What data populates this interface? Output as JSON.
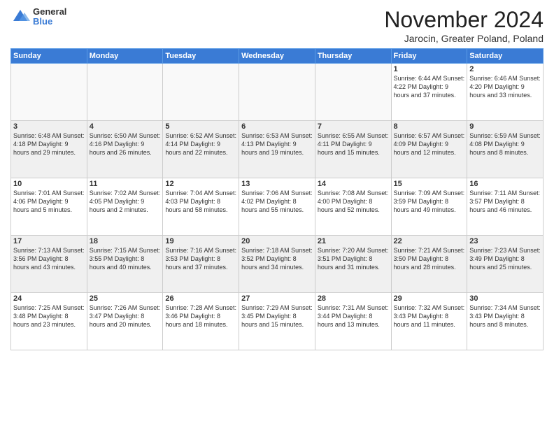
{
  "logo": {
    "general": "General",
    "blue": "Blue"
  },
  "header": {
    "title": "November 2024",
    "location": "Jarocin, Greater Poland, Poland"
  },
  "weekdays": [
    "Sunday",
    "Monday",
    "Tuesday",
    "Wednesday",
    "Thursday",
    "Friday",
    "Saturday"
  ],
  "weeks": [
    [
      {
        "day": "",
        "info": ""
      },
      {
        "day": "",
        "info": ""
      },
      {
        "day": "",
        "info": ""
      },
      {
        "day": "",
        "info": ""
      },
      {
        "day": "",
        "info": ""
      },
      {
        "day": "1",
        "info": "Sunrise: 6:44 AM\nSunset: 4:22 PM\nDaylight: 9 hours and 37 minutes."
      },
      {
        "day": "2",
        "info": "Sunrise: 6:46 AM\nSunset: 4:20 PM\nDaylight: 9 hours and 33 minutes."
      }
    ],
    [
      {
        "day": "3",
        "info": "Sunrise: 6:48 AM\nSunset: 4:18 PM\nDaylight: 9 hours and 29 minutes."
      },
      {
        "day": "4",
        "info": "Sunrise: 6:50 AM\nSunset: 4:16 PM\nDaylight: 9 hours and 26 minutes."
      },
      {
        "day": "5",
        "info": "Sunrise: 6:52 AM\nSunset: 4:14 PM\nDaylight: 9 hours and 22 minutes."
      },
      {
        "day": "6",
        "info": "Sunrise: 6:53 AM\nSunset: 4:13 PM\nDaylight: 9 hours and 19 minutes."
      },
      {
        "day": "7",
        "info": "Sunrise: 6:55 AM\nSunset: 4:11 PM\nDaylight: 9 hours and 15 minutes."
      },
      {
        "day": "8",
        "info": "Sunrise: 6:57 AM\nSunset: 4:09 PM\nDaylight: 9 hours and 12 minutes."
      },
      {
        "day": "9",
        "info": "Sunrise: 6:59 AM\nSunset: 4:08 PM\nDaylight: 9 hours and 8 minutes."
      }
    ],
    [
      {
        "day": "10",
        "info": "Sunrise: 7:01 AM\nSunset: 4:06 PM\nDaylight: 9 hours and 5 minutes."
      },
      {
        "day": "11",
        "info": "Sunrise: 7:02 AM\nSunset: 4:05 PM\nDaylight: 9 hours and 2 minutes."
      },
      {
        "day": "12",
        "info": "Sunrise: 7:04 AM\nSunset: 4:03 PM\nDaylight: 8 hours and 58 minutes."
      },
      {
        "day": "13",
        "info": "Sunrise: 7:06 AM\nSunset: 4:02 PM\nDaylight: 8 hours and 55 minutes."
      },
      {
        "day": "14",
        "info": "Sunrise: 7:08 AM\nSunset: 4:00 PM\nDaylight: 8 hours and 52 minutes."
      },
      {
        "day": "15",
        "info": "Sunrise: 7:09 AM\nSunset: 3:59 PM\nDaylight: 8 hours and 49 minutes."
      },
      {
        "day": "16",
        "info": "Sunrise: 7:11 AM\nSunset: 3:57 PM\nDaylight: 8 hours and 46 minutes."
      }
    ],
    [
      {
        "day": "17",
        "info": "Sunrise: 7:13 AM\nSunset: 3:56 PM\nDaylight: 8 hours and 43 minutes."
      },
      {
        "day": "18",
        "info": "Sunrise: 7:15 AM\nSunset: 3:55 PM\nDaylight: 8 hours and 40 minutes."
      },
      {
        "day": "19",
        "info": "Sunrise: 7:16 AM\nSunset: 3:53 PM\nDaylight: 8 hours and 37 minutes."
      },
      {
        "day": "20",
        "info": "Sunrise: 7:18 AM\nSunset: 3:52 PM\nDaylight: 8 hours and 34 minutes."
      },
      {
        "day": "21",
        "info": "Sunrise: 7:20 AM\nSunset: 3:51 PM\nDaylight: 8 hours and 31 minutes."
      },
      {
        "day": "22",
        "info": "Sunrise: 7:21 AM\nSunset: 3:50 PM\nDaylight: 8 hours and 28 minutes."
      },
      {
        "day": "23",
        "info": "Sunrise: 7:23 AM\nSunset: 3:49 PM\nDaylight: 8 hours and 25 minutes."
      }
    ],
    [
      {
        "day": "24",
        "info": "Sunrise: 7:25 AM\nSunset: 3:48 PM\nDaylight: 8 hours and 23 minutes."
      },
      {
        "day": "25",
        "info": "Sunrise: 7:26 AM\nSunset: 3:47 PM\nDaylight: 8 hours and 20 minutes."
      },
      {
        "day": "26",
        "info": "Sunrise: 7:28 AM\nSunset: 3:46 PM\nDaylight: 8 hours and 18 minutes."
      },
      {
        "day": "27",
        "info": "Sunrise: 7:29 AM\nSunset: 3:45 PM\nDaylight: 8 hours and 15 minutes."
      },
      {
        "day": "28",
        "info": "Sunrise: 7:31 AM\nSunset: 3:44 PM\nDaylight: 8 hours and 13 minutes."
      },
      {
        "day": "29",
        "info": "Sunrise: 7:32 AM\nSunset: 3:43 PM\nDaylight: 8 hours and 11 minutes."
      },
      {
        "day": "30",
        "info": "Sunrise: 7:34 AM\nSunset: 3:43 PM\nDaylight: 8 hours and 8 minutes."
      }
    ]
  ]
}
